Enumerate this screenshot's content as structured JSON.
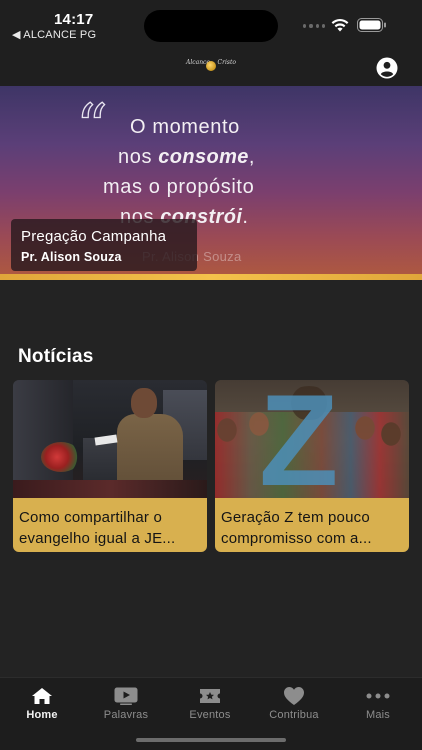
{
  "status_bar": {
    "time": "14:17",
    "back_label": "◀ ALCANCE PG"
  },
  "header": {
    "logo_text_left": "Alcance",
    "logo_text_right": "Cristo",
    "profile_icon": "user-circle-icon"
  },
  "banner": {
    "quote_line_1": "O momento",
    "quote_line_2_plain": "nos ",
    "quote_line_2_bold": "consome",
    "quote_line_2_end": ",",
    "quote_line_3": "mas o propósito",
    "quote_line_4_plain": "nos ",
    "quote_line_4_bold": "constrói",
    "quote_line_4_end": ".",
    "author": "Pr. Alison Souza",
    "caption_title": "Pregação Campanha",
    "caption_subtitle": "Pr. Alison Souza",
    "accent_color": "#f4c24b"
  },
  "news": {
    "section_title": "Notícias",
    "items": [
      {
        "line1": "Como compartilhar o",
        "line2": "evangelho igual a JE..."
      },
      {
        "line1": "Geração Z tem pouco",
        "line2": "compromisso com a..."
      }
    ],
    "caption_color": "#d8b04f"
  },
  "tab_bar": {
    "tabs": [
      {
        "label": "Home",
        "icon": "home-icon",
        "active": true
      },
      {
        "label": "Palavras",
        "icon": "video-play-icon",
        "active": false
      },
      {
        "label": "Eventos",
        "icon": "ticket-icon",
        "active": false
      },
      {
        "label": "Contribua",
        "icon": "heart-icon",
        "active": false
      },
      {
        "label": "Mais",
        "icon": "more-dots-icon",
        "active": false
      }
    ]
  }
}
